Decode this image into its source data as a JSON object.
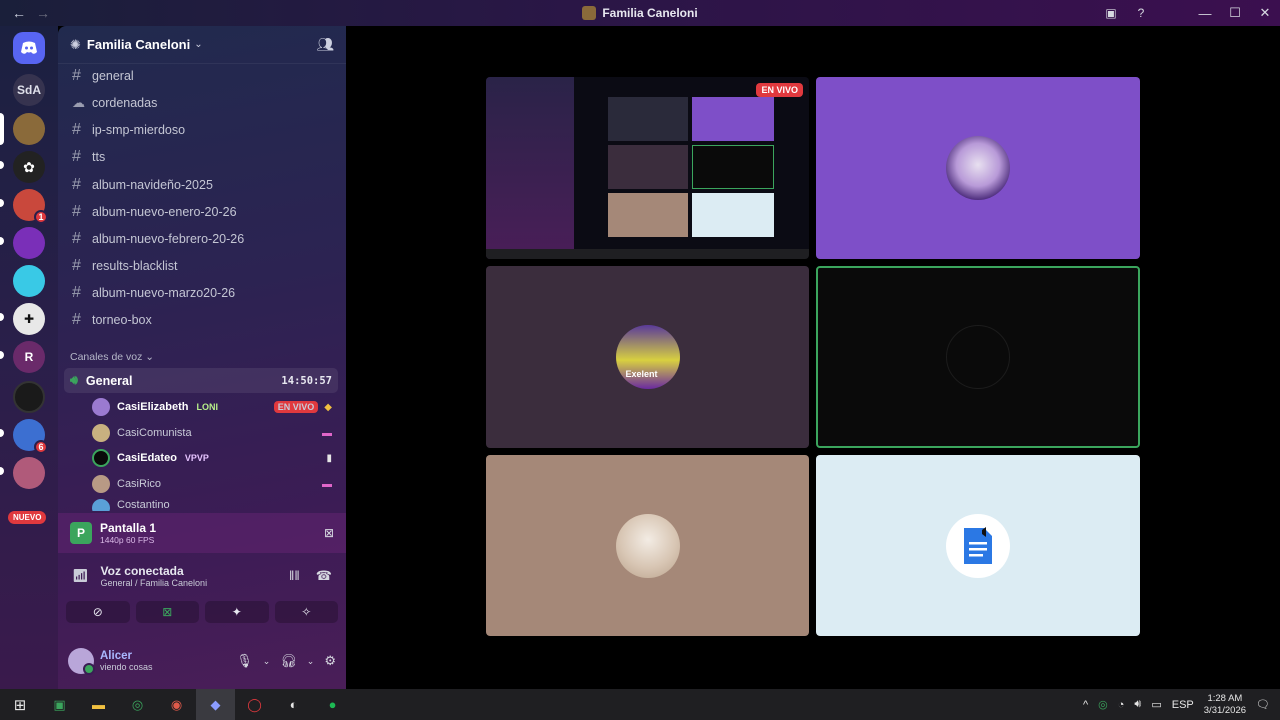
{
  "titlebar": {
    "back": "←",
    "forward": "→",
    "title": "Familia Caneloni",
    "inbox_icon": "inbox-icon",
    "help_icon": "help-icon",
    "minimize": "—",
    "maximize": "☐",
    "close": "✕"
  },
  "rail": {
    "home_label": "",
    "sda_label": "SdA",
    "nuevo_label": "NUEVO",
    "badges": {
      "server_3": "1",
      "server_10": "6"
    }
  },
  "server": {
    "name": "Familia Caneloni"
  },
  "channels": [
    {
      "name": "general",
      "icon": "#"
    },
    {
      "name": "cordenadas",
      "icon": "forum"
    },
    {
      "name": "ip-smp-mierdoso",
      "icon": "#"
    },
    {
      "name": "tts",
      "icon": "#"
    },
    {
      "name": "album-navideño-2025",
      "icon": "#"
    },
    {
      "name": "album-nuevo-enero-20-26",
      "icon": "#"
    },
    {
      "name": "album-nuevo-febrero-20-26",
      "icon": "#"
    },
    {
      "name": "results-blacklist",
      "icon": "#"
    },
    {
      "name": "album-nuevo-marzo20-26",
      "icon": "#"
    },
    {
      "name": "torneo-box",
      "icon": "#"
    }
  ],
  "voice_category": "Canales de voz",
  "voice_channel": {
    "name": "General",
    "timer": "14:50:57"
  },
  "voice_users": [
    {
      "name": "CasiElizabeth",
      "tag": "LONI",
      "live": "EN VIVO"
    },
    {
      "name": "CasiComunista",
      "tag": "",
      "live": ""
    },
    {
      "name": "CasiEdateo",
      "tag": "VPVP",
      "live": ""
    },
    {
      "name": "CasiRico",
      "tag": "",
      "live": ""
    },
    {
      "name": "Costantino",
      "tag": "",
      "live": ""
    }
  ],
  "stream_panel": {
    "title": "Pantalla 1",
    "quality": "1440p 60 FPS"
  },
  "voice_panel": {
    "status": "Voz conectada",
    "location": "General / Familia Caneloni"
  },
  "user": {
    "name": "Alicer",
    "status": "viendo cosas"
  },
  "stage": {
    "live_label": "EN VIVO",
    "avatar_caption": "Exelent"
  },
  "taskbar": {
    "lang": "ESP",
    "time": "1:28 AM",
    "date": "3/31/2026"
  },
  "colors": {
    "accent_green": "#3ba55d",
    "live_red": "#e0393e",
    "tile_purple": "#7e4fc8",
    "tile_dark": "#3b2d3d",
    "tile_black": "#0a0a0a",
    "tile_tan": "#a58878",
    "tile_light": "#dcecf3"
  }
}
